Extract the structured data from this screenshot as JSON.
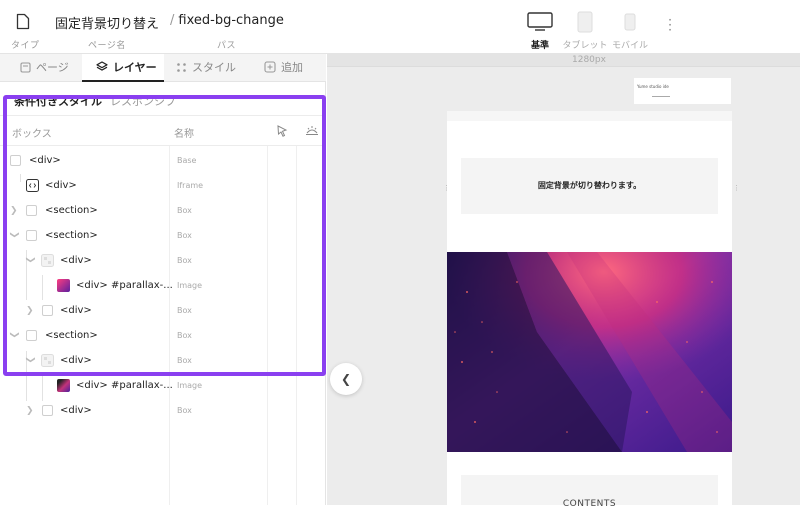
{
  "topbar": {
    "type_label": "タイプ",
    "page_name": "固定背景切り替え",
    "page_name_label": "ページ名",
    "path_slash": "/",
    "path": "fixed-bg-change",
    "path_label": "パス",
    "devices": [
      {
        "label": "基準",
        "icon": "desktop-icon",
        "active": true
      },
      {
        "label": "タブレット",
        "icon": "tablet-icon",
        "active": false
      },
      {
        "label": "モバイル",
        "icon": "mobile-icon",
        "active": false
      }
    ]
  },
  "panel": {
    "tabs": [
      {
        "label": "ページ",
        "icon": "page-icon"
      },
      {
        "label": "レイヤー",
        "icon": "layers-icon",
        "active": true
      },
      {
        "label": "スタイル",
        "icon": "style-icon"
      },
      {
        "label": "追加",
        "icon": "add-icon"
      }
    ],
    "subtabs": [
      {
        "label": "条件付きスタイル",
        "active": true
      },
      {
        "label": "レスポンシブ"
      }
    ],
    "columns": {
      "box": "ボックス",
      "name": "名称"
    },
    "layers": [
      {
        "tag": "<div>",
        "type": "Base"
      },
      {
        "tag": "<div>",
        "type": "Iframe"
      },
      {
        "tag": "<section>",
        "type": "Box"
      },
      {
        "tag": "<section>",
        "type": "Box"
      },
      {
        "tag": "<div>",
        "type": "Box"
      },
      {
        "tag": "<div> #parallax-...",
        "type": "Image"
      },
      {
        "tag": "<div>",
        "type": "Box"
      },
      {
        "tag": "<section>",
        "type": "Box"
      },
      {
        "tag": "<div>",
        "type": "Box"
      },
      {
        "tag": "<div> #parallax-...",
        "type": "Image"
      },
      {
        "tag": "<div>",
        "type": "Box"
      }
    ],
    "highlight_color": "#8a3ff0"
  },
  "canvas": {
    "width_label": "1280px",
    "mini_text": "Yume studio ide",
    "banner_text": "固定背景が切り替わります。",
    "contents_text": "CONTENTS"
  }
}
